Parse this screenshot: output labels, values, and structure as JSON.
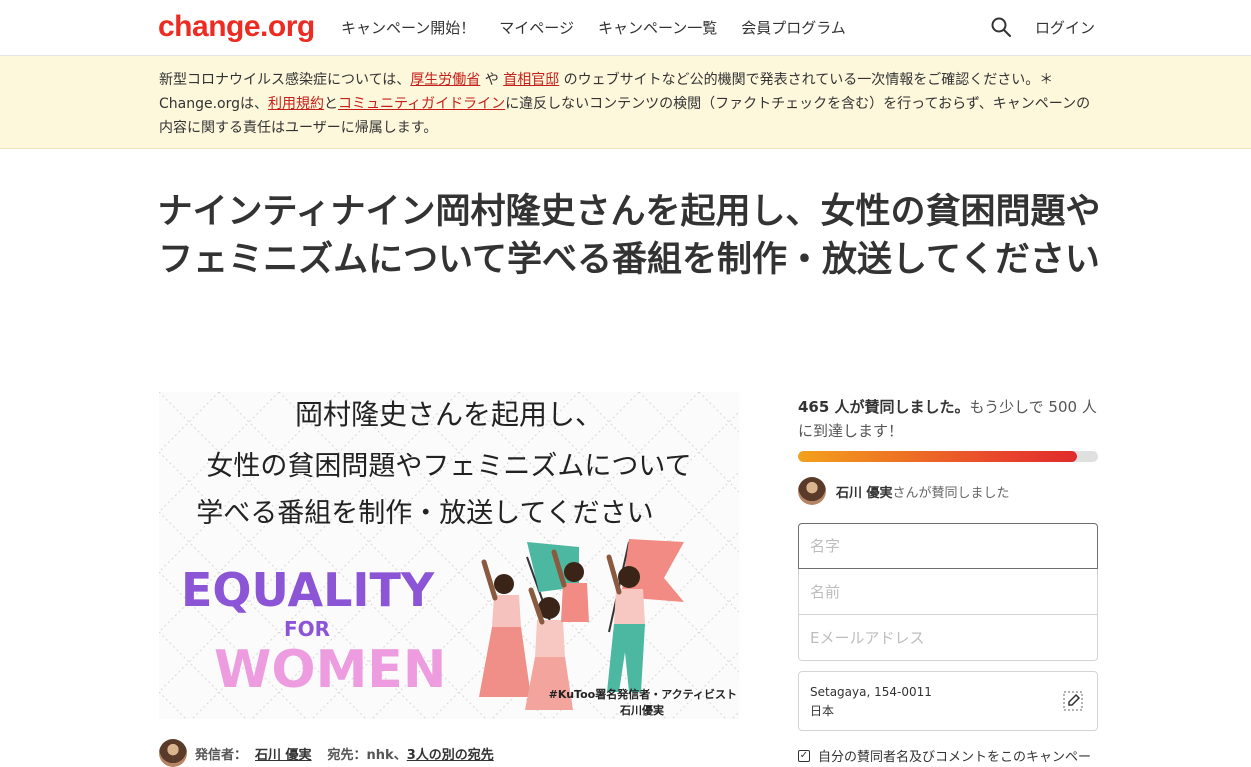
{
  "header": {
    "logo": "change.org",
    "nav": [
      "キャンペーン開始！",
      "マイページ",
      "キャンペーン一覧",
      "会員プログラム"
    ],
    "login": "ログイン",
    "search_icon": "search-icon"
  },
  "notice": {
    "t1": "新型コロナウイルス感染症については、",
    "link1": "厚生労働省",
    "t2": " や ",
    "link2": "首相官邸",
    "t3": " のウェブサイトなど公的機関で発表されている一次情報をご確認ください。＊Change.orgは、",
    "link3": "利用規約",
    "t4": "と",
    "link4": "コミュニティガイドライン",
    "t5": "に違反しないコンテンツの検閲（ファクトチェックを含む）を行っておらず、キャンペーンの内容に関する責任はユーザーに帰属します。"
  },
  "title": "ナインティナイン岡村隆史さんを起用し、女性の貧困問題やフェミニズムについて学べる番組を制作・放送してください",
  "petition_image": {
    "line1": "岡村隆史さんを起用し、",
    "line2": "女性の貧困問題やフェミニズムについて",
    "line3": "学べる番組を制作・放送してください",
    "equality": "EQUALITY",
    "for": "FOR",
    "women": "WOMEN",
    "credit1": "#KuToo署名発信者・アクティビスト",
    "credit2": "石川優実"
  },
  "meta": {
    "starter_label": "発信者：",
    "starter_name": "石川 優実",
    "to_label": "宛先：nhk、",
    "to_more": "3人の別の宛先"
  },
  "sidebar": {
    "count_bold": "465 人が賛同しました。",
    "count_rest": "もう少しで 500 人に到達します！",
    "progress_fraction": 0.93,
    "recent_name": "石川 優実",
    "recent_suffix": "さんが賛同しました",
    "placeholder_last": "名字",
    "placeholder_first": "名前",
    "placeholder_email": "Eメールアドレス",
    "location_line1": "Setagaya, 154-0011",
    "location_line2": "日本",
    "consent": "自分の賛同者名及びコメントをこのキャンペー"
  },
  "colors": {
    "brand": "#ec2c22",
    "notice_bg": "#fdf7dc",
    "link": "#c51f1a",
    "equality": "#8b55d6",
    "women": "#ee9ce0"
  }
}
